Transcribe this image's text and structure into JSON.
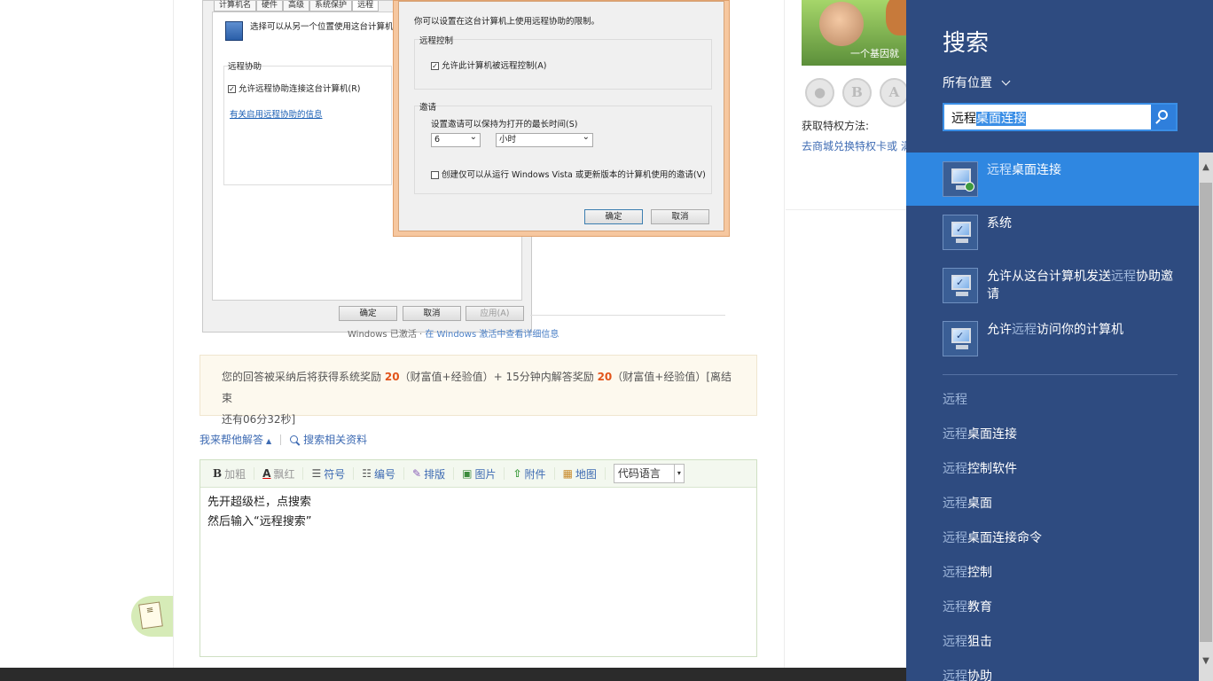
{
  "embedded_screenshot": {
    "back_dialog": {
      "tabs": [
        "计算机名",
        "硬件",
        "高级",
        "系统保护",
        "远程"
      ],
      "intro": "选择可以从另一个位置使用这台计算机的",
      "group_label": "远程协助",
      "checkbox_label": "允许远程协助连接这台计算机(R)",
      "link": "有关启用远程协助的信息",
      "ok": "确定",
      "cancel": "取消",
      "apply": "应用(A)"
    },
    "front_dialog": {
      "intro": "你可以设置在这台计算机上使用远程协助的限制。",
      "remote_control_group": "远程控制",
      "remote_control_checkbox": "允许此计算机被远程控制(A)",
      "invite_group": "邀请",
      "invite_time_label": "设置邀请可以保持为打开的最长时间(S)",
      "invite_number": "6",
      "invite_unit": "小时",
      "vista_checkbox": "创建仅可以从运行 Windows Vista 或更新版本的计算机使用的邀请(V)",
      "ok": "确定",
      "cancel": "取消"
    },
    "caption_prefix": "Windows 已激活",
    "caption_link": "在 Windows 激活中查看详细信息"
  },
  "notice": {
    "text_1": "您的回答被采纳后将获得系统奖励",
    "num_1": "20",
    "text_2": "（财富值+经验值）+ 15分钟内解答奖励",
    "num_2": "20",
    "text_3": "（财富值+经验值）[离结束",
    "text_4": "还有06分32秒]"
  },
  "actions": {
    "help_answer": "我来帮他解答",
    "search_related": "搜索相关资料"
  },
  "editor": {
    "toolbar": [
      {
        "icon": "B",
        "label": "加粗",
        "dim": true,
        "name": "bold"
      },
      {
        "icon": "A",
        "label": "飘红",
        "dim": true,
        "name": "red"
      },
      {
        "icon": "⋮≡",
        "label": "符号",
        "dim": false,
        "name": "bullet"
      },
      {
        "icon": "⋮≡",
        "label": "编号",
        "dim": false,
        "name": "number"
      },
      {
        "icon": "✎",
        "label": "排版",
        "dim": false,
        "name": "layout"
      },
      {
        "icon": "▣",
        "label": "图片",
        "dim": false,
        "name": "image"
      },
      {
        "icon": "⇧",
        "label": "附件",
        "dim": false,
        "name": "attach"
      },
      {
        "icon": "▦",
        "label": "地图",
        "dim": false,
        "name": "map"
      }
    ],
    "code_select": "代码语言",
    "lines": [
      "先开超级栏，点搜索",
      "然后输入“远程搜索”"
    ]
  },
  "right_col": {
    "banner_text": "一个基因就",
    "badges": [
      "",
      "B",
      "A",
      ""
    ],
    "priv_label": "获取特权方法:",
    "priv_link": "去商城兑换特权卡或 满"
  },
  "charm": {
    "title": "搜索",
    "scope": "所有位置",
    "query_plain": "远程",
    "query_selected": "桌面连接",
    "results": [
      {
        "hl": "远程",
        "rest": "桌面连接",
        "pre": "",
        "active": true,
        "icon": "remote-desktop-icon"
      },
      {
        "hl": "",
        "rest": "系统",
        "pre": "",
        "active": false,
        "icon": "system-icon"
      },
      {
        "pre": "允许从这台计算机发送",
        "hl": "远程",
        "rest": "协助邀请",
        "active": false,
        "icon": "remote-assist-icon"
      },
      {
        "pre": "允许",
        "hl": "远程",
        "rest": "访问你的计算机",
        "active": false,
        "icon": "remote-access-icon"
      }
    ],
    "suggestions": [
      {
        "hl": "远程",
        "rest": ""
      },
      {
        "hl": "远程",
        "rest": "桌面连接"
      },
      {
        "hl": "远程",
        "rest": "控制软件"
      },
      {
        "hl": "远程",
        "rest": "桌面"
      },
      {
        "hl": "远程",
        "rest": "桌面连接命令"
      },
      {
        "hl": "远程",
        "rest": "控制"
      },
      {
        "hl": "远程",
        "rest": "教育"
      },
      {
        "hl": "远程",
        "rest": "狙击"
      },
      {
        "hl": "远程",
        "rest": "协助"
      }
    ]
  },
  "colors": {
    "charm_bg": "#2e4b80",
    "active_result": "#2f87e1",
    "link_blue": "#3e6bb3",
    "reward_orange": "#e2541a"
  }
}
